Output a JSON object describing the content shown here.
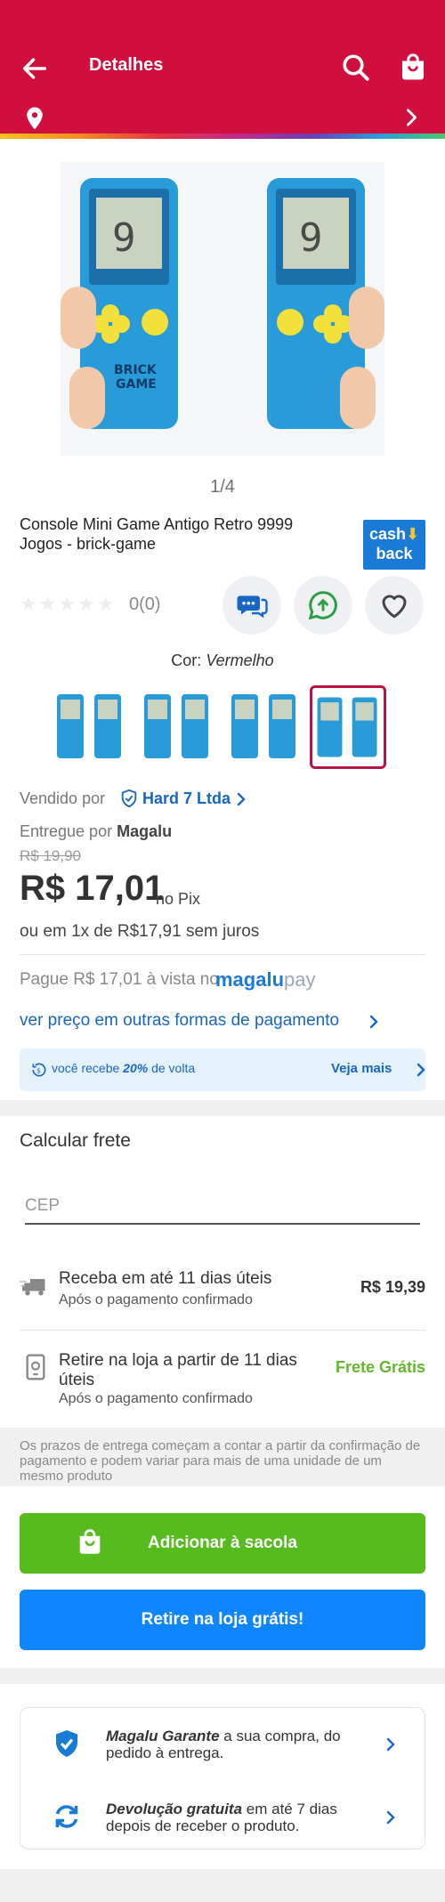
{
  "header": {
    "title": "Detalhes"
  },
  "gallery": {
    "pager": "1/4"
  },
  "product": {
    "title": "Console Mini Game Antigo Retro 9999 Jogos - brick-game",
    "cashback_badge": {
      "line1": "cash",
      "line2": "back"
    },
    "stars": "★★★★★",
    "rating_count": "0(0)",
    "color_label": "Cor:",
    "color_value": "Vermelho"
  },
  "seller": {
    "sold_by_label": "Vendido por",
    "sold_by_name": "Hard 7 Ltda",
    "delivered_by_label": "Entregue por",
    "delivered_by_name": "Magalu"
  },
  "pricing": {
    "old_price": "R$ 19,90",
    "price": "R$ 17,01",
    "pix_label": "no Pix",
    "installments": "ou em 1x de R$17,91 sem juros",
    "pay_line": "Pague R$ 17,01 à vista no",
    "magalupay_brand": "magalu",
    "magalupay_suffix": "pay",
    "other_payments": "ver preço em outras formas de pagamento",
    "cashback_text_pre": "você recebe",
    "cashback_percent": "20%",
    "cashback_text_post": "de volta",
    "cashback_more": "Veja mais"
  },
  "shipping": {
    "title": "Calcular frete",
    "cep_placeholder": "CEP",
    "option1_main": "Receba em até 11 dias úteis",
    "option1_sub": "Após o pagamento confirmado",
    "option1_price": "R$ 19,39",
    "option2_main": "Retire na loja a partir de 11 dias úteis",
    "option2_sub": "Após o pagamento confirmado",
    "option2_price": "Frete Grátis",
    "notice": "Os prazos de entrega começam a contar a partir da confirmação de pagamento e podem variar para mais de uma unidade de um mesmo produto"
  },
  "actions": {
    "add_to_bag": "Adicionar à sacola",
    "pickup_free": "Retire na loja grátis!"
  },
  "guarantees": {
    "g1_bold": "Magalu Garante",
    "g1_text": " a sua compra, do pedido à entrega.",
    "g2_bold": "Devolução gratuita",
    "g2_text": " em até 7 dias depois de receber o produto."
  },
  "colors": {
    "header_red": "#d10f3f",
    "seller_blue": "#1866c4",
    "add_green": "#56bb1d",
    "pickup_blue": "#0f86ff",
    "free_green": "#62b82b",
    "selected_thumb": "#b71444"
  }
}
